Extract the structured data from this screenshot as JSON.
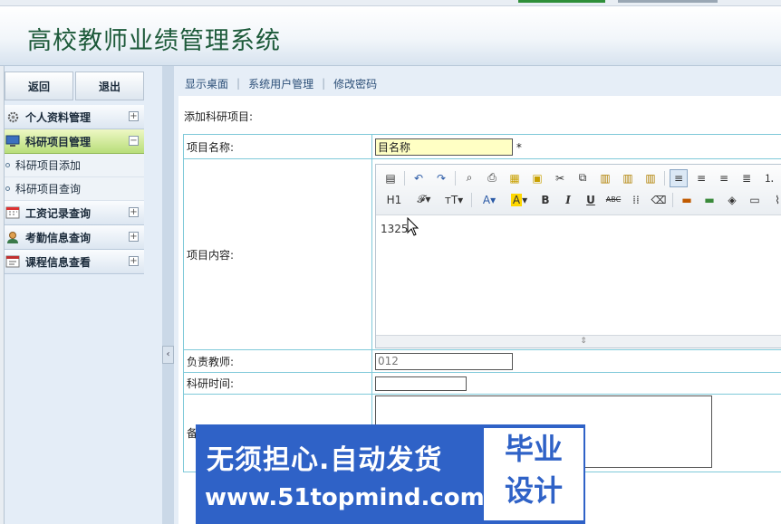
{
  "app": {
    "title": "高校教师业绩管理系统"
  },
  "sidebar": {
    "back_label": "返回",
    "logout_label": "退出",
    "menu": [
      {
        "label": "个人资料管理",
        "icon": "gear-icon",
        "expanded": false
      },
      {
        "label": "科研项目管理",
        "icon": "monitor-icon",
        "expanded": true,
        "items": [
          {
            "label": "科研项目添加"
          },
          {
            "label": "科研项目查询"
          }
        ]
      },
      {
        "label": "工资记录查询",
        "icon": "calendar-icon",
        "expanded": false
      },
      {
        "label": "考勤信息查询",
        "icon": "user-icon",
        "expanded": false
      },
      {
        "label": "课程信息查看",
        "icon": "calendar-icon",
        "expanded": false
      }
    ],
    "toggle_collapsed": "+",
    "toggle_expanded": "−",
    "collapse_arrow": "‹"
  },
  "tabs": [
    {
      "label": "显示桌面"
    },
    {
      "label": "系统用户管理"
    },
    {
      "label": "修改密码"
    }
  ],
  "tab_separator": "|",
  "form": {
    "title": "添加科研项目:",
    "name_label": "项目名称:",
    "name_value": "目名称",
    "required_mark": "*",
    "content_label": "项目内容:",
    "content_value": "1325",
    "teacher_label": "负责教师:",
    "teacher_value": "012",
    "time_label": "科研时间:",
    "time_value": "",
    "remark_label": "备",
    "remark_value": ""
  },
  "editor": {
    "heading_label": "H1",
    "resize_handle": "⇕"
  },
  "banner": {
    "line1": "无须担心.自动发货",
    "line2": "www.51topmind.com",
    "box_line1": "毕业",
    "box_line2": "设计"
  }
}
